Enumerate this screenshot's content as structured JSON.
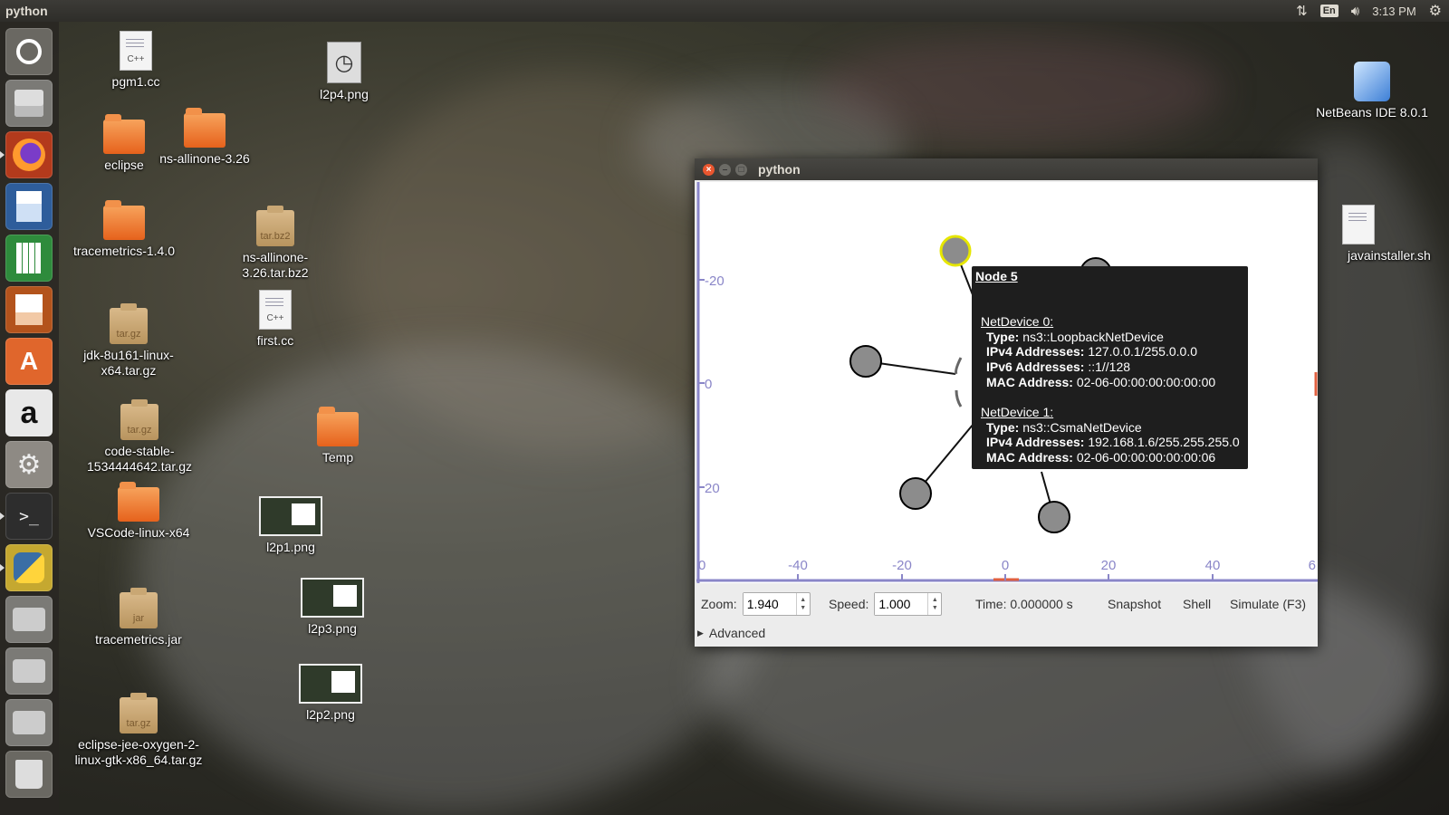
{
  "top_panel": {
    "app_name": "python",
    "keyboard_layout": "En",
    "clock": "3:13 PM",
    "icons": [
      "network-icon",
      "keyboard-layout-icon",
      "volume-icon",
      "settings-gear-icon"
    ]
  },
  "launcher": {
    "items": [
      {
        "name": "ubuntu-dash",
        "icon": "ubuntu-logo-icon"
      },
      {
        "name": "files",
        "icon": "file-cabinet-icon"
      },
      {
        "name": "firefox",
        "icon": "firefox-icon"
      },
      {
        "name": "libreoffice-writer",
        "icon": "writer-doc-icon"
      },
      {
        "name": "libreoffice-calc",
        "icon": "calc-sheet-icon"
      },
      {
        "name": "libreoffice-impress",
        "icon": "impress-slide-icon"
      },
      {
        "name": "ubuntu-software",
        "icon": "shopping-bag-icon"
      },
      {
        "name": "amazon",
        "icon": "amazon-icon"
      },
      {
        "name": "system-settings",
        "icon": "settings-tools-icon"
      },
      {
        "name": "terminal",
        "icon": "terminal-icon"
      },
      {
        "name": "python",
        "icon": "python-icon"
      },
      {
        "name": "drive-1",
        "icon": "hard-drive-icon"
      },
      {
        "name": "drive-2",
        "icon": "hard-drive-icon"
      },
      {
        "name": "drive-3",
        "icon": "hard-drive-icon"
      },
      {
        "name": "trash",
        "icon": "trash-icon"
      }
    ],
    "terminal_prompt": ">_",
    "amazon_letter": "a",
    "software_letter": "A"
  },
  "desktop": {
    "icons": [
      {
        "label": "pgm1.cc",
        "type": "doc",
        "sub": "C++"
      },
      {
        "label": "l2p4.png",
        "type": "clock"
      },
      {
        "label": "eclipse",
        "type": "folder"
      },
      {
        "label": "ns-allinone-3.26",
        "type": "folder"
      },
      {
        "label": "NetBeans IDE 8.0.1",
        "type": "netbeans"
      },
      {
        "label": "tracemetrics-1.4.0",
        "type": "folder"
      },
      {
        "label": "ns-allinone-3.26.tar.bz2",
        "type": "archive",
        "sub": "tar.bz2"
      },
      {
        "label": "first.cc",
        "type": "doc",
        "sub": "C++"
      },
      {
        "label": "jdk-8u161-linux-x64.tar.gz",
        "type": "archive",
        "sub": "tar.gz"
      },
      {
        "label": "code-stable-1534444642.tar.gz",
        "type": "archive",
        "sub": "tar.gz"
      },
      {
        "label": "Temp",
        "type": "folder"
      },
      {
        "label": "l2p1.png",
        "type": "thumb"
      },
      {
        "label": "VSCode-linux-x64",
        "type": "folder"
      },
      {
        "label": "l2p3.png",
        "type": "thumb"
      },
      {
        "label": "tracemetrics.jar",
        "type": "archive",
        "sub": "jar"
      },
      {
        "label": "l2p2.png",
        "type": "thumb"
      },
      {
        "label": "eclipse-jee-oxygen-2-linux-gtk-x86_64.tar.gz",
        "type": "archive",
        "sub": "tar.gz"
      },
      {
        "label": "javainstaller.sh",
        "type": "doc",
        "sub": ""
      }
    ]
  },
  "window": {
    "title": "python",
    "axis": {
      "y_ticks": [
        "-20",
        "0",
        "20"
      ],
      "x_ticks": [
        "0",
        "-40",
        "-20",
        "0",
        "20",
        "40",
        "6"
      ]
    },
    "controls": {
      "zoom_label": "Zoom:",
      "zoom_value": "1.940",
      "speed_label": "Speed:",
      "speed_value": "1.000",
      "time_text": "Time: 0.000000 s",
      "snapshot": "Snapshot",
      "shell": "Shell",
      "simulate": "Simulate (F3)",
      "advanced": "Advanced"
    }
  },
  "tooltip": {
    "title": "Node 5",
    "devices": [
      {
        "header": "NetDevice 0:",
        "rows": [
          {
            "k": "Type:",
            "v": "ns3::LoopbackNetDevice"
          },
          {
            "k": "IPv4 Addresses:",
            "v": "127.0.0.1/255.0.0.0"
          },
          {
            "k": "IPv6 Addresses:",
            "v": "::1//128"
          },
          {
            "k": "MAC Address:",
            "v": "02-06-00:00:00:00:00:00"
          }
        ]
      },
      {
        "header": "NetDevice 1:",
        "rows": [
          {
            "k": "Type:",
            "v": "ns3::CsmaNetDevice"
          },
          {
            "k": "IPv4 Addresses:",
            "v": "192.168.1.6/255.255.255.0"
          },
          {
            "k": "MAC Address:",
            "v": "02-06-00:00:00:00:00:06"
          }
        ]
      }
    ]
  },
  "colors": {
    "panel": "#3c3b37",
    "axis": "#8a86c8",
    "node_fill": "#8c8c8c",
    "selected_outline": "#e6e600",
    "folder": "#e6621c",
    "tooltip_bg": "#1e1e1e"
  }
}
